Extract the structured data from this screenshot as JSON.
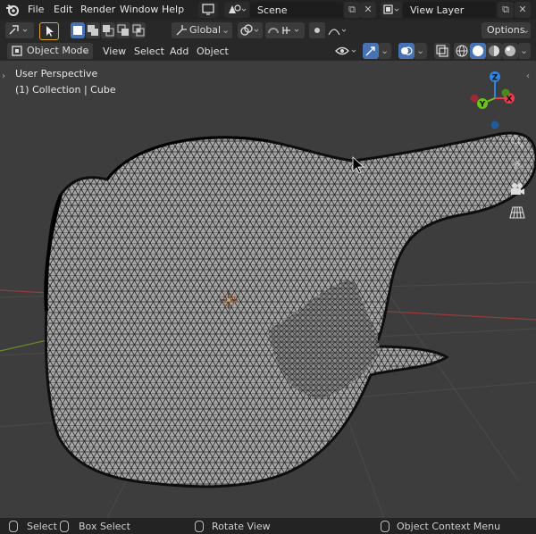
{
  "topbar": {
    "menus": [
      "File",
      "Edit",
      "Render",
      "Window",
      "Help"
    ],
    "scene": "Scene",
    "view_layer": "View Layer"
  },
  "header": {
    "transform_orientation": "Global",
    "options_label": "Options"
  },
  "viewport_header": {
    "mode": "Object Mode",
    "menus": [
      "View",
      "Select",
      "Add",
      "Object"
    ]
  },
  "viewport": {
    "perspective_label": "User Perspective",
    "collection_label": "(1) Collection | Cube",
    "gizmo_axes": [
      "X",
      "Y",
      "Z"
    ]
  },
  "statusbar": {
    "select": "Select",
    "box_select": "Box Select",
    "rotate_view": "Rotate View",
    "context_menu": "Object Context Menu"
  },
  "colors": {
    "x_axis": "#ee3a4e",
    "y_axis": "#6bc41d",
    "z_axis": "#2f86e0",
    "accent": "#4772b3"
  }
}
